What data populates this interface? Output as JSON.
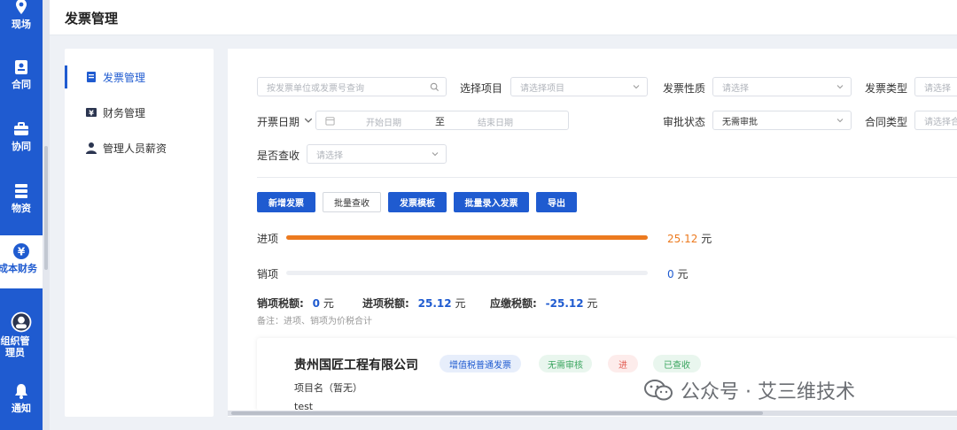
{
  "rail": {
    "items": [
      {
        "label": "现场",
        "icon": "location-pin-icon"
      },
      {
        "label": "合同",
        "icon": "contract-icon"
      },
      {
        "label": "协同",
        "icon": "briefcase-icon"
      },
      {
        "label": "物资",
        "icon": "storage-icon"
      },
      {
        "label": "成本财务",
        "icon": "yuan-icon"
      },
      {
        "label": "组织管理员",
        "icon": "avatar-icon"
      },
      {
        "label": "通知",
        "icon": "bell-icon"
      }
    ],
    "active_index": 4
  },
  "header": {
    "title": "发票管理"
  },
  "submenu": {
    "items": [
      {
        "label": "发票管理",
        "icon": "invoice-icon"
      },
      {
        "label": "财务管理",
        "icon": "money-icon"
      },
      {
        "label": "管理人员薪资",
        "icon": "person-icon"
      }
    ],
    "active_index": 0
  },
  "filters": {
    "search_placeholder": "按发票单位或发票号查询",
    "project_label": "选择项目",
    "project_placeholder": "请选择项目",
    "nature_label": "发票性质",
    "nature_placeholder": "请选择",
    "type_label": "发票类型",
    "type_placeholder": "请选择",
    "date_label": "开票日期",
    "start_placeholder": "开始日期",
    "date_sep": "至",
    "end_placeholder": "结束日期",
    "approval_label": "审批状态",
    "approval_value": "无需审批",
    "contract_label": "合同类型",
    "contract_placeholder": "请选择合",
    "checked_label": "是否查收",
    "checked_placeholder": "请选择"
  },
  "buttons": {
    "new_invoice": "新增发票",
    "batch_check": "批量查收",
    "template": "发票模板",
    "batch_import": "批量录入发票",
    "export": "导出"
  },
  "summary": {
    "income_label": "进项",
    "income_value": "25.12",
    "income_fill": 1.0,
    "outgoing_label": "销项",
    "outgoing_value": "0",
    "outgoing_fill": 0.0,
    "unit": "元",
    "out_tax_label": "销项税额:",
    "out_tax_value": "0",
    "in_tax_label": "进项税额:",
    "in_tax_value": "25.12",
    "pay_tax_label": "应缴税额:",
    "pay_tax_value": "-25.12",
    "note": "备注：进项、销项为价税合计"
  },
  "card": {
    "company": "贵州国匠工程有限公司",
    "tags": [
      "增值税普通发票",
      "无需审核",
      "进",
      "已查收"
    ],
    "project": "项目名（暂无）",
    "test": "test"
  },
  "watermark": {
    "text": "公众号 · 艾三维技术"
  },
  "colors": {
    "brand": "#1f5bd0",
    "orange": "#ec7a1f",
    "negative": "#1f5bd0"
  }
}
